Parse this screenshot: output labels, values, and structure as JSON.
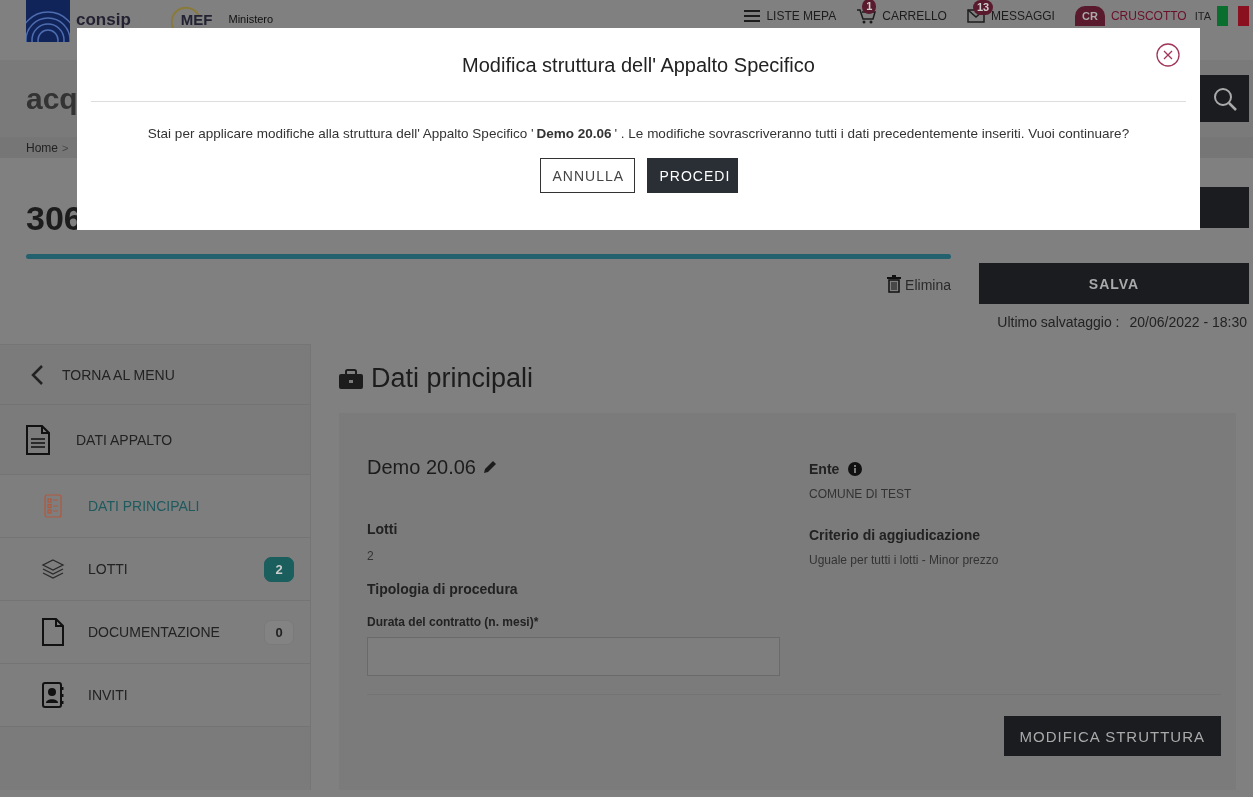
{
  "header": {
    "logo_text": "consip",
    "ministry_logo_text": "MEF",
    "ministry_text": "Ministero",
    "nav": [
      {
        "kind": "menu",
        "label": "LISTE MEPA"
      },
      {
        "kind": "cart",
        "label": "CARRELLO",
        "badge": "1"
      },
      {
        "kind": "mail",
        "label": "MESSAGGI",
        "badge": "13"
      },
      {
        "kind": "user",
        "label": "CRUSCOTTO",
        "initials": "CR"
      }
    ],
    "language": "ITA"
  },
  "brand_bar": {
    "text": "acq"
  },
  "breadcrumb": {
    "items": [
      "Home"
    ],
    "separator": ">"
  },
  "page_title": "306",
  "actions": {
    "delete": "Elimina",
    "save": "SALVA",
    "last_saved_label": "Ultimo salvataggio :",
    "last_saved_value": "20/06/2022 - 18:30"
  },
  "sidebar": {
    "back": "TORNA AL MENU",
    "section": "DATI APPALTO",
    "items": [
      {
        "kind": "checklist",
        "label": "DATI PRINCIPALI",
        "selected": true
      },
      {
        "kind": "layers",
        "label": "LOTTI",
        "badge": "2",
        "badge_active": true,
        "selected": false
      },
      {
        "kind": "file",
        "label": "DOCUMENTAZIONE",
        "badge": "0",
        "badge_active": false,
        "selected": false
      },
      {
        "kind": "contacts",
        "label": "INVITI",
        "selected": false
      }
    ]
  },
  "content": {
    "title": "Dati principali",
    "name": "Demo 20.06",
    "left_fields": [
      {
        "label": "Lotti",
        "value": "2"
      },
      {
        "label": "Tipologia di procedura"
      }
    ],
    "input": {
      "label": "Durata del contratto (n. mesi)*"
    },
    "right_fields": [
      {
        "label": "Ente",
        "info": true,
        "value": "COMUNE DI TEST"
      },
      {
        "label": "Criterio di aggiudicazione",
        "info": false,
        "value": "Uguale per tutti i lotti - Minor prezzo"
      }
    ],
    "button": "MODIFICA STRUTTURA"
  },
  "modal": {
    "title": "Modifica struttura dell' Appalto Specifico",
    "message": "Stai per applicare modifiche alla struttura dell' Appalto Specifico ' **Demo 20.06** ' . Le modifiche sovrascriveranno tutti i dati precedentemente inseriti. Vuoi continuare?",
    "buttons": [
      {
        "kind": "secondary",
        "label": "ANNULLA"
      },
      {
        "kind": "primary",
        "label": "PROCEDI"
      }
    ]
  }
}
